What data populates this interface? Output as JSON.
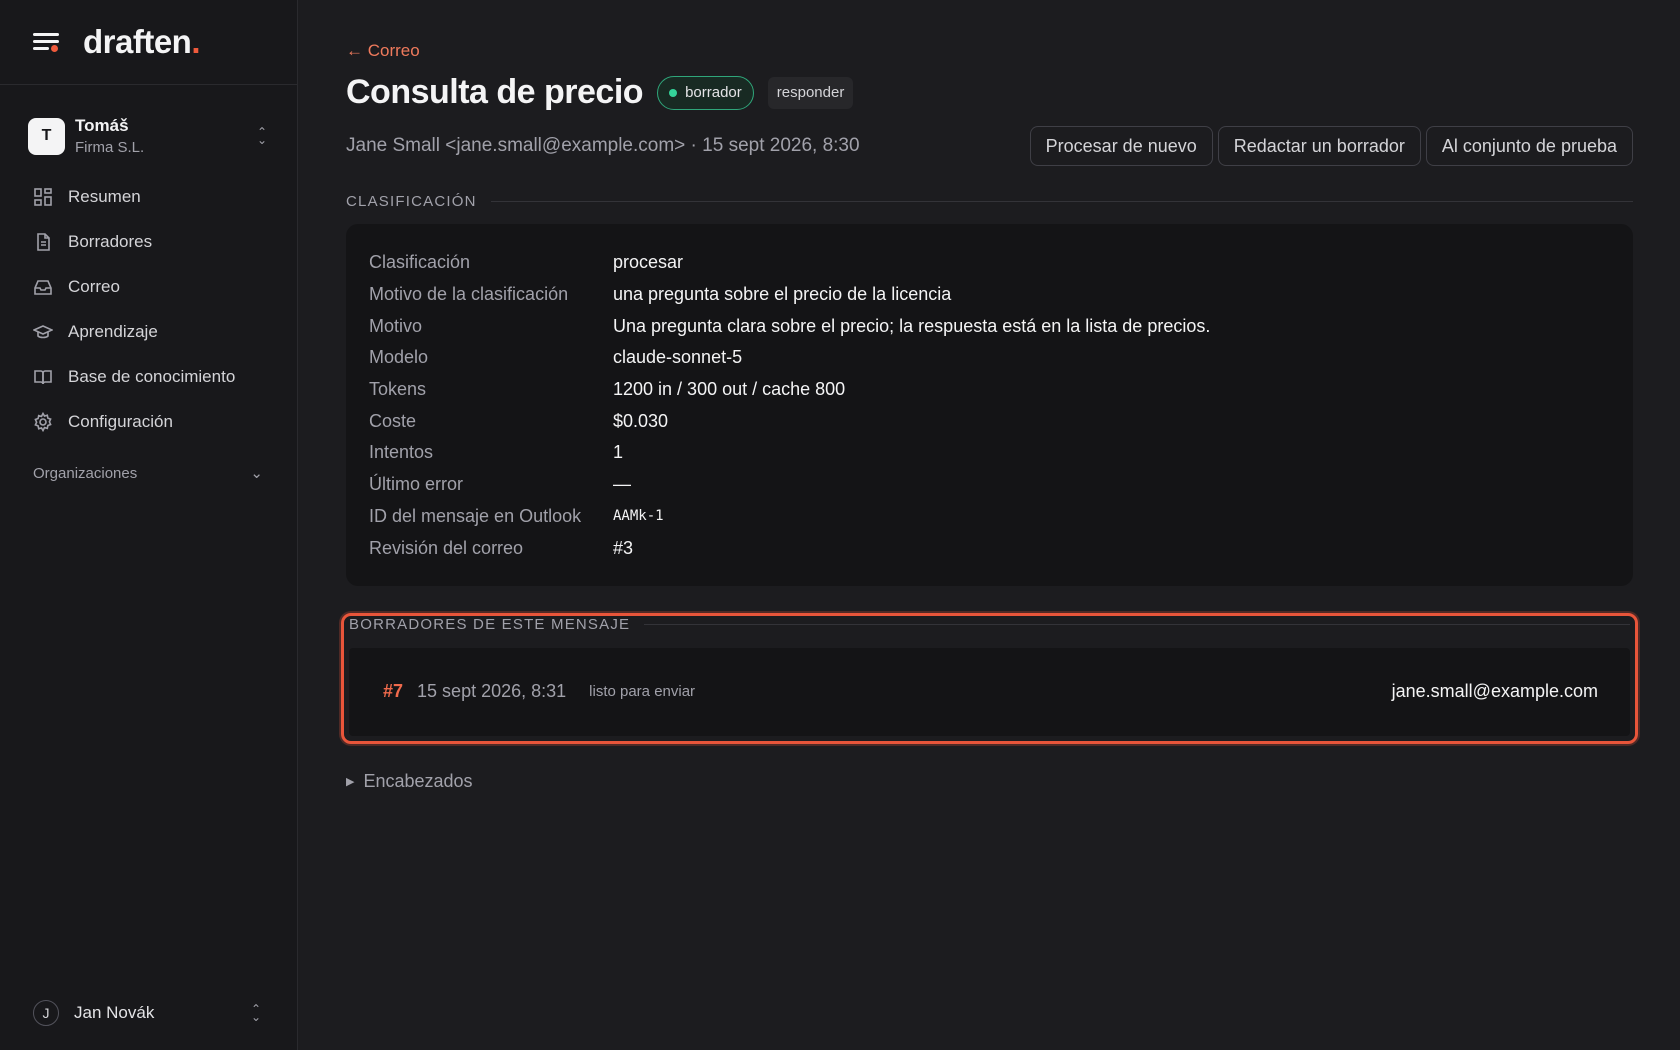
{
  "brand": {
    "name": "draften",
    "dot": "."
  },
  "account": {
    "initial": "T",
    "name": "Tomáš",
    "company": "Firma S.L."
  },
  "nav": [
    {
      "label": "Resumen",
      "icon": "grid-icon"
    },
    {
      "label": "Borradores",
      "icon": "document-icon"
    },
    {
      "label": "Correo",
      "icon": "inbox-icon"
    },
    {
      "label": "Aprendizaje",
      "icon": "graduation-cap-icon"
    },
    {
      "label": "Base de conocimiento",
      "icon": "book-icon"
    },
    {
      "label": "Configuración",
      "icon": "gear-icon"
    }
  ],
  "orgs_label": "Organizaciones",
  "user": {
    "initial": "J",
    "name": "Jan Novák"
  },
  "back_link": "← Correo",
  "title": "Consulta de precio",
  "status_badge": "borrador",
  "type_badge": "responder",
  "meta": "Jane Small <jane.small@example.com> · 15 sept 2026, 8:30",
  "actions": {
    "reprocess": "Procesar de nuevo",
    "draft": "Redactar un borrador",
    "test_set": "Al conjunto de prueba"
  },
  "classification": {
    "section_title": "CLASIFICACIÓN",
    "rows": [
      {
        "k": "Clasificación",
        "v": "procesar"
      },
      {
        "k": "Motivo de la clasificación",
        "v": "una pregunta sobre el precio de la licencia"
      },
      {
        "k": "Motivo",
        "v": "Una pregunta clara sobre el precio; la respuesta está en la lista de precios."
      },
      {
        "k": "Modelo",
        "v": "claude-sonnet-5"
      },
      {
        "k": "Tokens",
        "v": "1200 in / 300 out / cache 800"
      },
      {
        "k": "Coste",
        "v": "$0.030"
      },
      {
        "k": "Intentos",
        "v": "1"
      },
      {
        "k": "Último error",
        "v": "—"
      },
      {
        "k": "ID del mensaje en Outlook",
        "v": "AAMk-1"
      },
      {
        "k": "Revisión del correo",
        "v": "#3"
      }
    ]
  },
  "drafts": {
    "section_title": "BORRADORES DE ESTE MENSAJE",
    "items": [
      {
        "num": "#7",
        "date": "15 sept 2026, 8:31",
        "state": "listo para enviar",
        "to": "jane.small@example.com"
      }
    ]
  },
  "headers_label": "Encabezados",
  "colors": {
    "accent": "#ef5a3c",
    "status_green": "#34d399",
    "highlight": "#e8553a"
  }
}
